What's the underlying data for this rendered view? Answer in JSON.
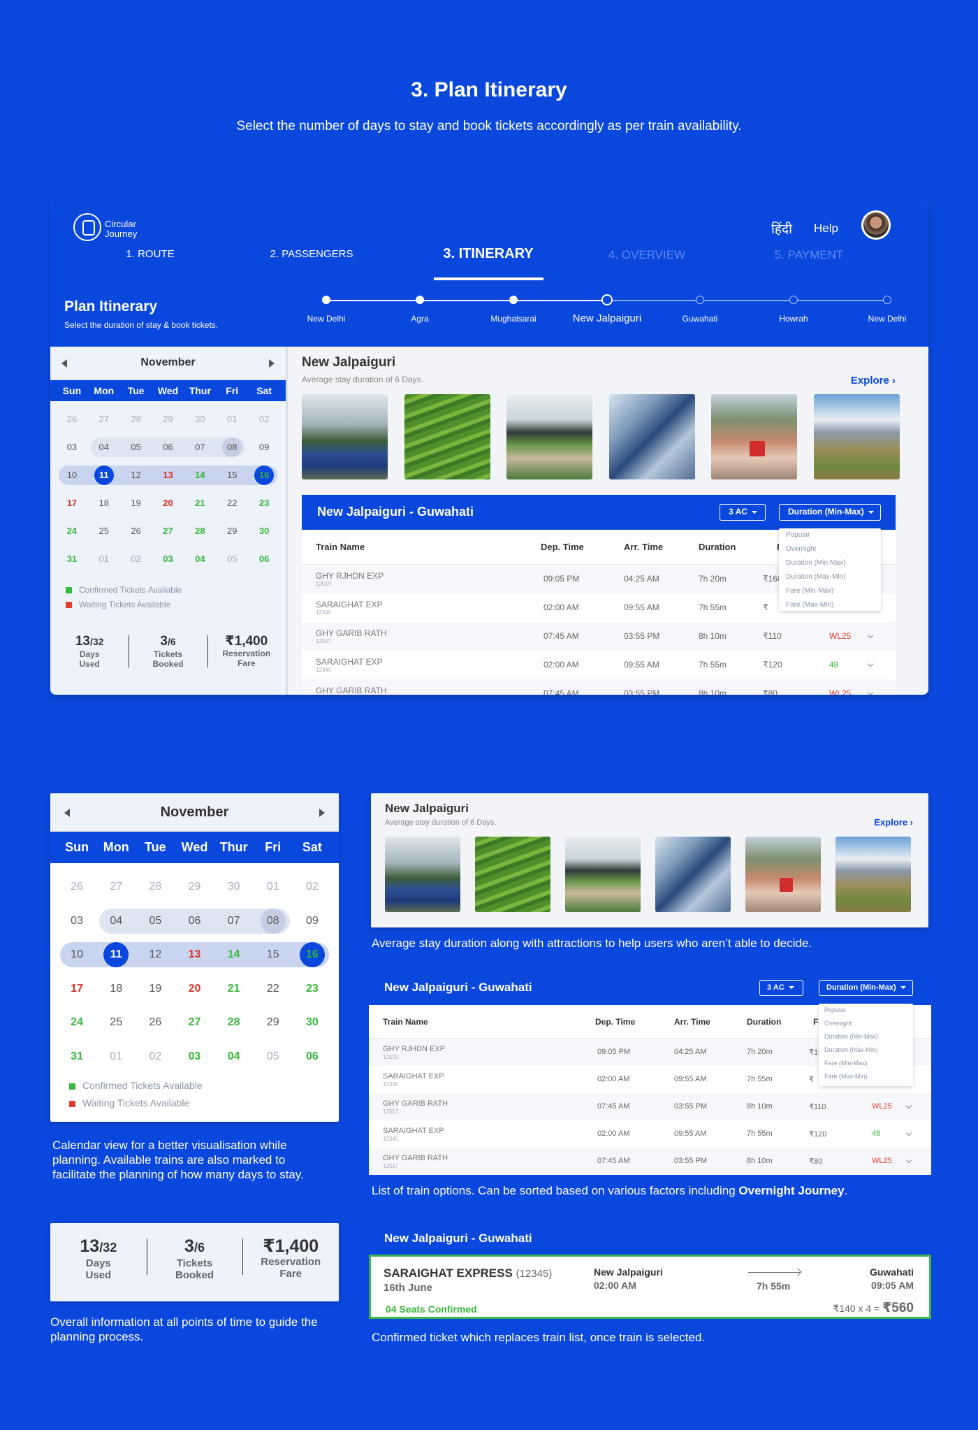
{
  "hero": {
    "title": "3. Plan Itinerary",
    "subtitle": "Select the number of days to stay and book tickets accordingly as per train availability."
  },
  "header": {
    "logo_line1": "Circular",
    "logo_line2": "Journey",
    "lang": "हिंदी",
    "help": "Help",
    "steps": [
      "1. ROUTE",
      "2. PASSENGERS",
      "3. ITINERARY",
      "4. OVERVIEW",
      "5. PAYMENT"
    ]
  },
  "left_panel": {
    "title": "Plan Itinerary",
    "subtitle": "Select the duration of stay & book tickets."
  },
  "calendar": {
    "month": "November",
    "days": [
      "Sun",
      "Mon",
      "Tue",
      "Wed",
      "Thur",
      "Fri",
      "Sat"
    ],
    "rows": [
      [
        "26",
        "27",
        "28",
        "29",
        "30",
        "01",
        "02"
      ],
      [
        "03",
        "04",
        "05",
        "06",
        "07",
        "08",
        "09"
      ],
      [
        "10",
        "11",
        "12",
        "13",
        "14",
        "15",
        "16"
      ],
      [
        "17",
        "18",
        "19",
        "20",
        "21",
        "22",
        "23"
      ],
      [
        "24",
        "25",
        "26",
        "27",
        "28",
        "29",
        "30"
      ],
      [
        "31",
        "01",
        "02",
        "03",
        "04",
        "05",
        "06"
      ]
    ],
    "legend_confirmed": "Confirmed Tickets Available",
    "legend_waiting": "Waiting Tickets Available",
    "colors": {
      "confirmed": "#36b83a",
      "waiting": "#e13d2f",
      "primary": "#0a47dd"
    }
  },
  "stats": {
    "days_used": "13",
    "days_total": "/32",
    "days_label1": "Days",
    "days_label2": "Used",
    "tickets": "3",
    "tickets_total": "/6",
    "tickets_label1": "Tickets",
    "tickets_label2": "Booked",
    "fare": "₹1,400",
    "fare_label1": "Reservation",
    "fare_label2": "Fare"
  },
  "route": {
    "stops": [
      "New Delhi",
      "Agra",
      "Mughalsarai",
      "New Jalpaiguri",
      "Guwahati",
      "Howrah",
      "New Delhi"
    ],
    "current": "New Jalpaiguri"
  },
  "place": {
    "title": "New Jalpaiguri",
    "subtitle": "Average stay duration of 6 Days.",
    "explore": "Explore ›"
  },
  "trains": {
    "title": "New Jalpaiguri - Guwahati",
    "class": "3 AC",
    "sort": "Duration (Min-Max)",
    "columns": [
      "Train Name",
      "Dep. Time",
      "Arr. Time",
      "Duration",
      "Fare"
    ],
    "sort_options": [
      "Popular",
      "Overnight",
      "Duration (Min-Max)",
      "Duration (Max-Min)",
      "Fare (Min-Max)",
      "Fare (Max-Min)"
    ],
    "rows": [
      {
        "name": "GHY RJHDN EXP",
        "num": "12519",
        "dep": "09:05 PM",
        "arr": "04:25 AM",
        "dur": "7h 20m",
        "fare": "₹160",
        "seats": ""
      },
      {
        "name": "SARAIGHAT EXP",
        "num": "12345",
        "dep": "02:00 AM",
        "arr": "09:55 AM",
        "dur": "7h 55m",
        "fare": "₹",
        "seats": ""
      },
      {
        "name": "GHY GARIB RATH",
        "num": "12517",
        "dep": "07:45 AM",
        "arr": "03:55 PM",
        "dur": "8h 10m",
        "fare": "₹110",
        "seats": "WL25"
      },
      {
        "name": "SARAIGHAT EXP",
        "num": "12345",
        "dep": "02:00 AM",
        "arr": "09:55 AM",
        "dur": "7h 55m",
        "fare": "₹120",
        "seats": "48"
      },
      {
        "name": "GHY GARIB RATH",
        "num": "12517",
        "dep": "07:45 AM",
        "arr": "03:55 PM",
        "dur": "8h 10m",
        "fare": "₹80",
        "seats": "WL25"
      }
    ]
  },
  "captions": {
    "attractions": "Average stay duration along with attractions to help users who aren’t able to decide.",
    "calendar": "Calendar view for a better visualisation while planning. Available trains are also marked to facilitate the planning of how many days to stay.",
    "list_pre": "List of train options. Can be sorted based on various factors including ",
    "list_bold": "Overnight Journey",
    "list_post": ".",
    "stats": "Overall information at all points of time to guide the planning process.",
    "confirmed": "Confirmed ticket which replaces train list, once train is selected."
  },
  "confirmed": {
    "title": "New Jalpaiguri - Guwahati",
    "train": "SARAIGHAT EXPRESS",
    "train_num": "(12345)",
    "date": "16th June",
    "from": "New Jalpaiguri",
    "from_time": "02:00 AM",
    "duration": "7h 55m",
    "to": "Guwahati",
    "to_time": "09:05 AM",
    "seats": "04 Seats Confirmed",
    "fare_calc": "₹140 x 4 = ",
    "fare_total": "₹560"
  }
}
